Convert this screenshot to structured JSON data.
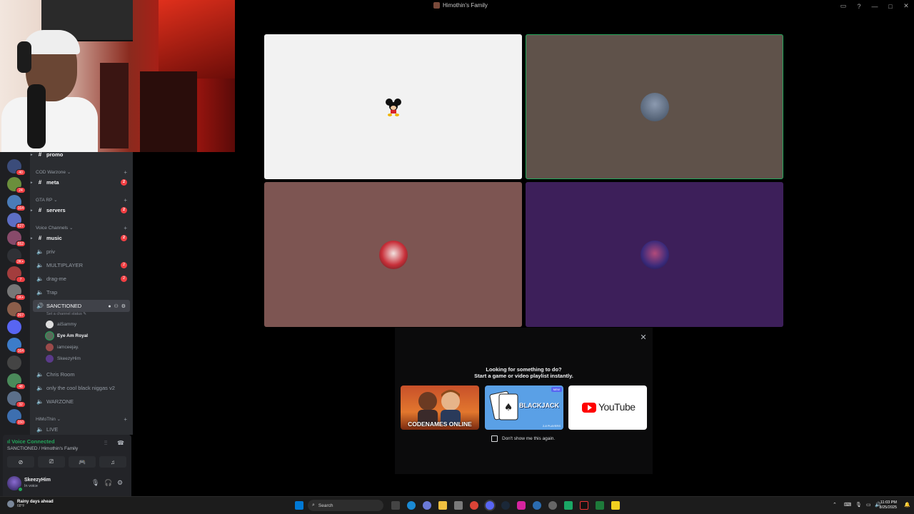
{
  "window": {
    "title": "Himothin's Family"
  },
  "titlebar_icons": [
    "inbox-icon",
    "help-icon",
    "minimize-icon",
    "maximize-icon",
    "close-icon"
  ],
  "guilds": [
    {
      "badge": "40",
      "color": "#3b4c7a"
    },
    {
      "badge": "24",
      "color": "#6b8f3c"
    },
    {
      "badge": "164",
      "color": "#4a7cb8"
    },
    {
      "badge": "527",
      "color": "#5d6ec4"
    },
    {
      "badge": "552",
      "color": "#884a6a"
    },
    {
      "badge": "2K+",
      "color": "#2f3136"
    },
    {
      "badge": "7",
      "color": "#a33d3d"
    },
    {
      "badge": "1K+",
      "color": "#777777"
    },
    {
      "badge": "267",
      "color": "#8b5e4a"
    },
    {
      "badge": "",
      "color": "#5865f2"
    },
    {
      "badge": "164",
      "color": "#3d7cc9"
    },
    {
      "badge": "",
      "color": "#444"
    },
    {
      "badge": "48",
      "color": "#4a8a5a"
    },
    {
      "badge": "32",
      "color": "#5b6f8a"
    },
    {
      "badge": "150",
      "color": "#3d6fb0"
    }
  ],
  "channels": {
    "promo": {
      "name": "promo"
    },
    "cod_category": "COD Warzone",
    "meta": {
      "name": "meta",
      "mention": "2"
    },
    "gta_category": "GTA RP",
    "servers": {
      "name": "servers",
      "mention": "2"
    },
    "voice_category": "Voice Channels",
    "music": {
      "name": "music",
      "mention": "2"
    },
    "priv": {
      "name": "priv"
    },
    "multiplayer": {
      "name": "MULTIPLAYER",
      "mention": "2"
    },
    "drag": {
      "name": "drag-me",
      "mention": "2"
    },
    "trap": {
      "name": "Trap"
    },
    "sanctioned": {
      "name": "SANCTIONED",
      "status": "Set a channel status"
    },
    "voice_users": [
      "aiSammy",
      "Eye Am Royal",
      "iamceejay.",
      "SkeezyHim"
    ],
    "chris": {
      "name": "Chris Room"
    },
    "cool": {
      "name": "only the cool black niggas v2"
    },
    "warzone": {
      "name": "WARZONE"
    },
    "himo_category": "HiMoThin",
    "live": {
      "name": "LIVE"
    }
  },
  "voice_panel": {
    "status": "Voice Connected",
    "location": "SANCTIONED / Himothin's Family"
  },
  "user": {
    "name": "SkeezyHim",
    "status": "In voice"
  },
  "tiles": [
    {
      "bg": "#f2f2f2",
      "avatar": "mickey-avatar"
    },
    {
      "bg": "#5f524a",
      "avatar": "user-avatar",
      "speaking": true
    },
    {
      "bg": "#7d5552",
      "avatar": "user-avatar"
    },
    {
      "bg": "#3d1f5a",
      "avatar": "user-avatar"
    }
  ],
  "activity": {
    "line1": "Looking for something to do?",
    "line2": "Start a game or video playlist instantly.",
    "cards": [
      {
        "label": "CODENAMES ONLINE",
        "kind": "codenames"
      },
      {
        "label": "BLACKJACK",
        "sublabel": "2-8 PLAYERS",
        "tag": "NEW",
        "kind": "blackjack"
      },
      {
        "label": "YouTube",
        "kind": "youtube"
      }
    ],
    "dont_show": "Don't show me this again."
  },
  "taskbar": {
    "weather_title": "Rainy days ahead",
    "weather_temp": "68°F",
    "search_placeholder": "Search",
    "time": "11:03 PM",
    "date": "8/25/2025"
  }
}
